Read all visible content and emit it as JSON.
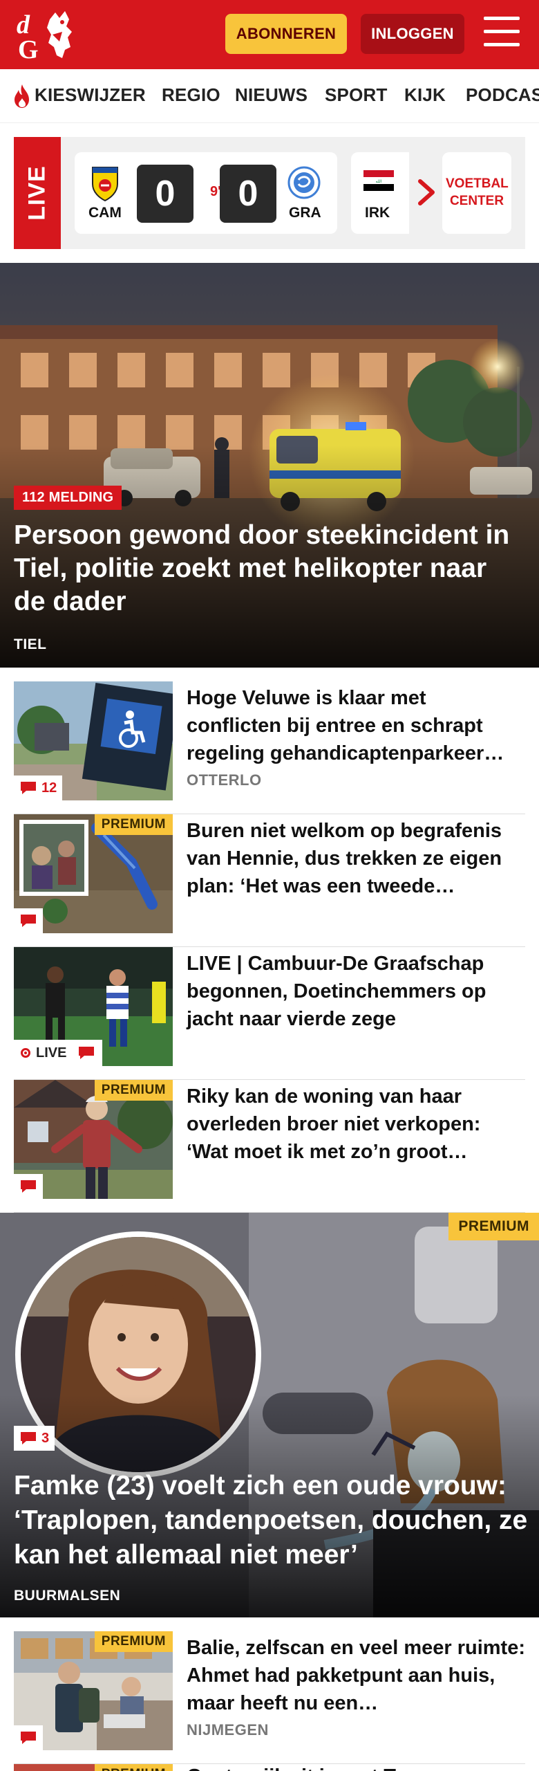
{
  "header": {
    "logo_text": "dG",
    "subscribe_label": "ABONNEREN",
    "login_label": "INLOGGEN",
    "menu_icon": "hamburger-menu-icon"
  },
  "nav": {
    "items": [
      {
        "label": "KIESWIJZER",
        "icon": "flame-icon"
      },
      {
        "label": "REGIO"
      },
      {
        "label": "NIEUWS"
      },
      {
        "label": "SPORT"
      },
      {
        "label": "KIJK"
      },
      {
        "label": "PODCAST"
      }
    ]
  },
  "live_scores": {
    "tag": "LIVE",
    "match": {
      "home": "CAM",
      "away": "GRA",
      "home_score": "0",
      "away_score": "0",
      "minute": "9'"
    },
    "next_match_team": "IRK",
    "voetbal_center_label": "VOETBAL CENTER"
  },
  "hero": {
    "label": "112 MELDING",
    "title": "Persoon gewond door steekincident in Tiel, politie zoekt met helikopter naar de dader",
    "location": "TIEL"
  },
  "articles": [
    {
      "title": "Hoge Veluwe is klaar met conflicten bij entree en schrapt regeling gehandicaptenparkeer…",
      "location": "OTTERLO",
      "comments": "12",
      "premium": false,
      "live": false
    },
    {
      "title": "Buren niet welkom op begrafenis van Hennie, dus trekken ze eigen plan: ‘Het was een tweede…",
      "location": "",
      "comments": "",
      "premium": true,
      "live": false
    },
    {
      "title": "LIVE | Cambuur-De Graafschap begonnen, Doetinchemmers op jacht naar vierde zege",
      "location": "",
      "comments": "",
      "premium": false,
      "live": true,
      "live_label": "LIVE"
    },
    {
      "title": "Riky kan de woning van haar overleden broer niet verkopen: ‘Wat moet ik met zo’n groot…",
      "location": "",
      "comments": "",
      "premium": true,
      "live": false
    }
  ],
  "premium_label": "PREMIUM",
  "feature": {
    "premium_label": "PREMIUM",
    "comments": "3",
    "title": "Famke (23) voelt zich een oude vrouw: ‘Traplopen, tandenpoetsen, douchen, ze kan het allemaal niet meer’",
    "location": "BUURMALSEN"
  },
  "article_after": {
    "title": "Balie, zelfscan en veel meer ruimte: Ahmet had pakketpunt aan huis, maar heeft nu een…",
    "location": "NIJMEGEN",
    "premium": true
  },
  "peek": {
    "premium_label": "PREMIUM",
    "title_fragment": "Oostenrijk zit in met Tr…"
  },
  "colors": {
    "brand_red": "#d6171d",
    "dark_red": "#a80f16",
    "premium_yellow": "#f8c43b"
  }
}
